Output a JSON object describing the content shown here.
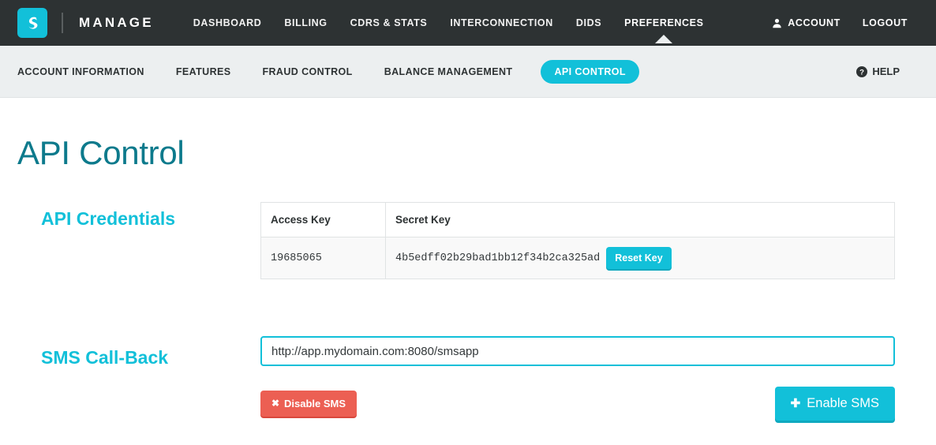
{
  "header": {
    "brand_name": "MANAGE",
    "logo_icon": "swirl-logo-icon",
    "nav": [
      {
        "label": "DASHBOARD",
        "active": false
      },
      {
        "label": "BILLING",
        "active": false
      },
      {
        "label": "CDRS & STATS",
        "active": false
      },
      {
        "label": "INTERCONNECTION",
        "active": false
      },
      {
        "label": "DIDS",
        "active": false
      },
      {
        "label": "PREFERENCES",
        "active": true
      }
    ],
    "account_label": "ACCOUNT",
    "account_icon": "user-icon",
    "logout_label": "LOGOUT"
  },
  "subnav": {
    "items": [
      {
        "label": "ACCOUNT INFORMATION",
        "active": false
      },
      {
        "label": "FEATURES",
        "active": false
      },
      {
        "label": "FRAUD CONTROL",
        "active": false
      },
      {
        "label": "BALANCE MANAGEMENT",
        "active": false
      },
      {
        "label": "API CONTROL",
        "active": true
      }
    ],
    "help_label": "HELP",
    "help_icon": "question-circle-icon"
  },
  "page": {
    "title": "API Control"
  },
  "credentials": {
    "section_label": "API Credentials",
    "columns": [
      "Access Key",
      "Secret Key"
    ],
    "row": {
      "access_key": "19685065",
      "secret_key": "4b5edff02b29bad1bb12f34b2ca325ad"
    },
    "reset_button": "Reset Key"
  },
  "sms": {
    "section_label": "SMS Call-Back",
    "url_value": "http://app.mydomain.com:8080/smsapp",
    "url_placeholder": "http://",
    "disable_button": "Disable SMS",
    "disable_icon": "close-x-icon",
    "enable_button": "Enable SMS",
    "enable_icon": "plus-icon"
  },
  "colors": {
    "header_bg": "#2d3233",
    "subnav_bg": "#eceff0",
    "accent_cyan": "#12c0d9",
    "title_teal": "#0d7a8c",
    "danger_red": "#ec5f53"
  }
}
